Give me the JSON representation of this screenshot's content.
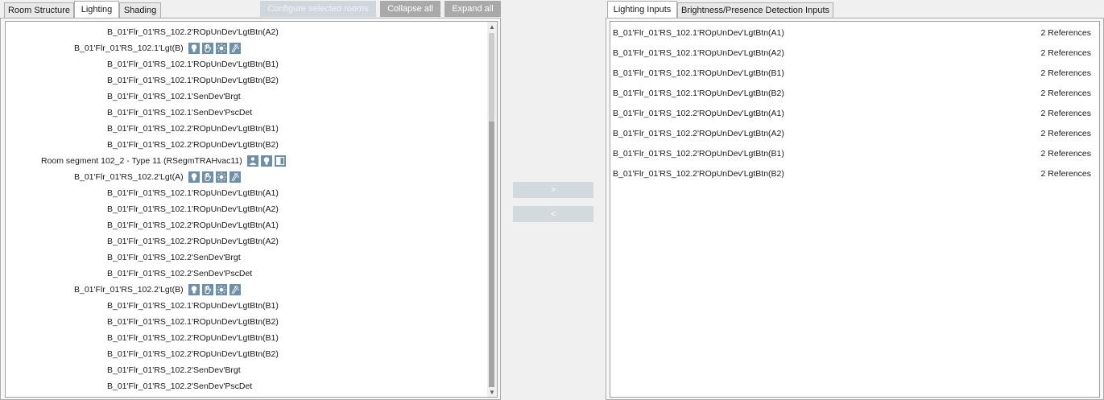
{
  "left_tabs": [
    "Room Structure",
    "Lighting",
    "Shading"
  ],
  "left_active_tab": "Lighting",
  "toolbar": {
    "configure_label": "Configure selected rooms",
    "collapse_label": "Collapse all",
    "expand_label": "Expand all"
  },
  "tree": [
    {
      "text": "B_01'Flr_01'RS_102.2'ROpUnDev'LgtBtn(A2)",
      "level": 3,
      "icons": []
    },
    {
      "text": "B_01'Flr_01'RS_102.1'Lgt(B)",
      "level": 2,
      "icons": [
        "light-bulb-icon",
        "hand-icon",
        "sun-icon",
        "shade-icon"
      ]
    },
    {
      "text": "B_01'Flr_01'RS_102.1'ROpUnDev'LgtBtn(B1)",
      "level": 3,
      "icons": []
    },
    {
      "text": "B_01'Flr_01'RS_102.1'ROpUnDev'LgtBtn(B2)",
      "level": 3,
      "icons": []
    },
    {
      "text": "B_01'Flr_01'RS_102.1'SenDev'Brgt",
      "level": 3,
      "icons": []
    },
    {
      "text": "B_01'Flr_01'RS_102.1'SenDev'PscDet",
      "level": 3,
      "icons": []
    },
    {
      "text": "B_01'Flr_01'RS_102.2'ROpUnDev'LgtBtn(B1)",
      "level": 3,
      "icons": []
    },
    {
      "text": "B_01'Flr_01'RS_102.2'ROpUnDev'LgtBtn(B2)",
      "level": 3,
      "icons": []
    },
    {
      "text": "Room segment 102_2 - Type 11 (RSegmTRAHvac11)",
      "level": 1,
      "icons": [
        "person-icon",
        "light-bulb-icon",
        "blind-icon"
      ]
    },
    {
      "text": "B_01'Flr_01'RS_102.2'Lgt(A)",
      "level": 2,
      "icons": [
        "light-bulb-icon",
        "hand-icon",
        "sun-icon",
        "shade-icon"
      ]
    },
    {
      "text": "B_01'Flr_01'RS_102.1'ROpUnDev'LgtBtn(A1)",
      "level": 3,
      "icons": []
    },
    {
      "text": "B_01'Flr_01'RS_102.1'ROpUnDev'LgtBtn(A2)",
      "level": 3,
      "icons": []
    },
    {
      "text": "B_01'Flr_01'RS_102.2'ROpUnDev'LgtBtn(A1)",
      "level": 3,
      "icons": []
    },
    {
      "text": "B_01'Flr_01'RS_102.2'ROpUnDev'LgtBtn(A2)",
      "level": 3,
      "icons": []
    },
    {
      "text": "B_01'Flr_01'RS_102.2'SenDev'Brgt",
      "level": 3,
      "icons": []
    },
    {
      "text": "B_01'Flr_01'RS_102.2'SenDev'PscDet",
      "level": 3,
      "icons": []
    },
    {
      "text": "B_01'Flr_01'RS_102.2'Lgt(B)",
      "level": 2,
      "icons": [
        "light-bulb-icon",
        "hand-icon",
        "sun-icon",
        "shade-icon"
      ]
    },
    {
      "text": "B_01'Flr_01'RS_102.1'ROpUnDev'LgtBtn(B1)",
      "level": 3,
      "icons": []
    },
    {
      "text": "B_01'Flr_01'RS_102.1'ROpUnDev'LgtBtn(B2)",
      "level": 3,
      "icons": []
    },
    {
      "text": "B_01'Flr_01'RS_102.2'ROpUnDev'LgtBtn(B1)",
      "level": 3,
      "icons": []
    },
    {
      "text": "B_01'Flr_01'RS_102.2'ROpUnDev'LgtBtn(B2)",
      "level": 3,
      "icons": []
    },
    {
      "text": "B_01'Flr_01'RS_102.2'SenDev'Brgt",
      "level": 3,
      "icons": []
    },
    {
      "text": "B_01'Flr_01'RS_102.2'SenDev'PscDet",
      "level": 3,
      "icons": []
    }
  ],
  "middle": {
    "assign_label": ">",
    "remove_label": "<"
  },
  "right_tabs": [
    "Lighting Inputs",
    "Brightness/Presence Detection Inputs"
  ],
  "right_active_tab": "Lighting Inputs",
  "inputs": [
    {
      "name": "B_01'Flr_01'RS_102.1'ROpUnDev'LgtBtn(A1)",
      "refs": "2  References"
    },
    {
      "name": "B_01'Flr_01'RS_102.1'ROpUnDev'LgtBtn(A2)",
      "refs": "2  References"
    },
    {
      "name": "B_01'Flr_01'RS_102.1'ROpUnDev'LgtBtn(B1)",
      "refs": "2  References"
    },
    {
      "name": "B_01'Flr_01'RS_102.1'ROpUnDev'LgtBtn(B2)",
      "refs": "2  References"
    },
    {
      "name": "B_01'Flr_01'RS_102.2'ROpUnDev'LgtBtn(A1)",
      "refs": "2  References"
    },
    {
      "name": "B_01'Flr_01'RS_102.2'ROpUnDev'LgtBtn(A2)",
      "refs": "2  References"
    },
    {
      "name": "B_01'Flr_01'RS_102.2'ROpUnDev'LgtBtn(B1)",
      "refs": "2  References"
    },
    {
      "name": "B_01'Flr_01'RS_102.2'ROpUnDev'LgtBtn(B2)",
      "refs": "2  References"
    }
  ],
  "colors": {
    "icon_bg": "#6f8ea8",
    "button_bg": "#a9a9a9",
    "button_disabled_bg": "#cfd7dd"
  }
}
